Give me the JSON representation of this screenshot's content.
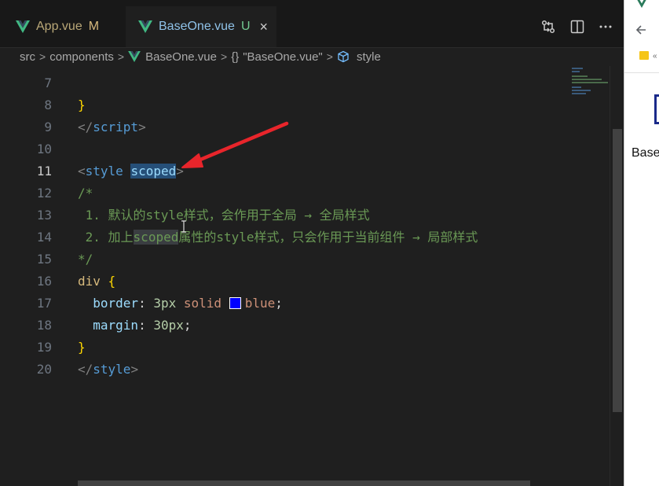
{
  "tabs": [
    {
      "name": "App.vue",
      "flag": "M"
    },
    {
      "name": "BaseOne.vue",
      "flag": "U",
      "close": "×"
    }
  ],
  "breadcrumb": {
    "src": "src",
    "components": "components",
    "file": "BaseOne.vue",
    "braces": "{}",
    "component": "\"BaseOne.vue\"",
    "style": "style"
  },
  "gutter": [
    "7",
    "8",
    "9",
    "10",
    "11",
    "12",
    "13",
    "14",
    "15",
    "16",
    "17",
    "18",
    "19",
    "20"
  ],
  "code": {
    "l8_brace": "}",
    "l9_open": "</",
    "l9_tag": "script",
    "l9_close": ">",
    "l11_open": "<",
    "l11_tag": "style",
    "l11_attr": "scoped",
    "l11_close": ">",
    "l12": "/*",
    "l13": " 1. 默认的style样式，会作用于全局 → 全局样式",
    "l14_a": " 2. 加上",
    "l14_b": "scoped",
    "l14_c": "属性的style样式，只会作用于当前组件 → 局部样式",
    "l15": "*/",
    "l16_sel": "div",
    "l16_brace": "{",
    "l17_prop": "border",
    "l17_colon": ": ",
    "l17_num": "3px",
    "l17_val1": "solid",
    "l17_val2": "blue",
    "l17_semi": ";",
    "l18_prop": "margin",
    "l18_colon": ": ",
    "l18_num": "30px",
    "l18_semi": ";",
    "l19_brace": "}",
    "l20_open": "</",
    "l20_tag": "style",
    "l20_close": ">"
  },
  "browser": {
    "text": "Base"
  },
  "colors": {
    "editor_bg": "#1f1f1f",
    "arrow": "#e8252b",
    "selection": "#264f78",
    "vue_green": "#41b883"
  },
  "icons": [
    "vue-logo-icon",
    "compare-changes-icon",
    "split-editor-icon",
    "more-actions-icon",
    "symbol-structure-icon",
    "back-arrow-icon",
    "folder-icon"
  ]
}
